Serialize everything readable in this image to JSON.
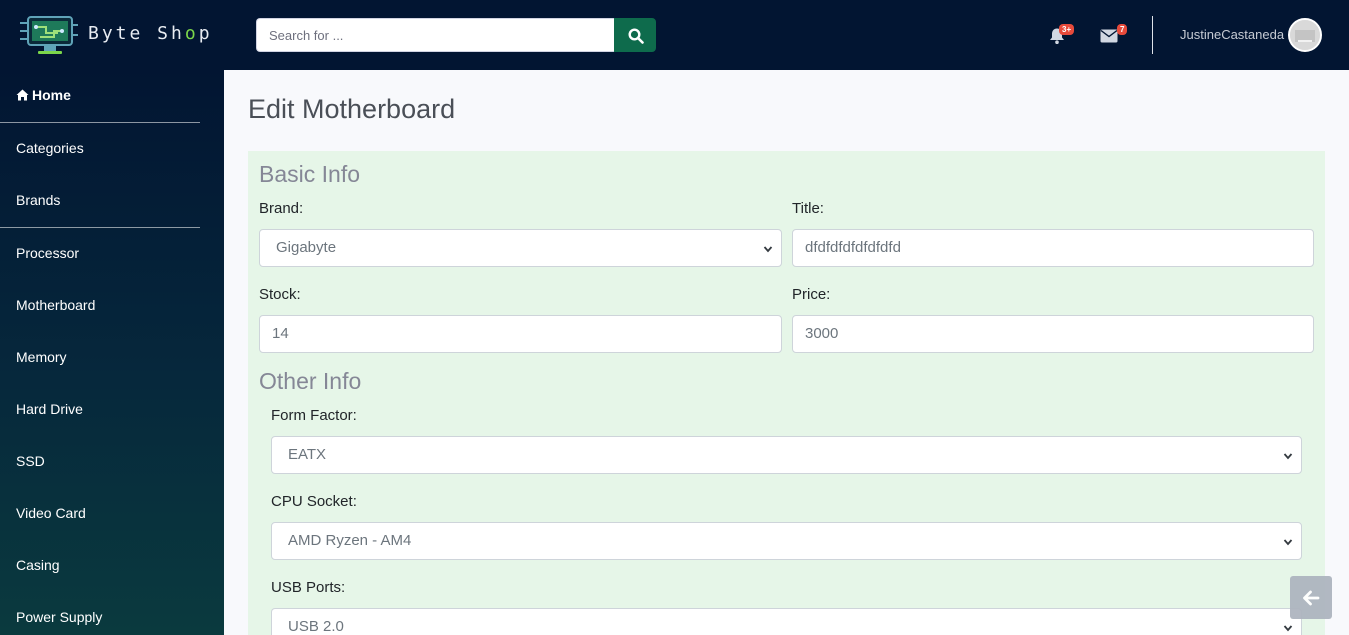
{
  "brand": {
    "name_part1": "Byte Sh",
    "name_o": "o",
    "name_part2": "p"
  },
  "search": {
    "placeholder": "Search for ..."
  },
  "notifications": {
    "alerts_count": "3+",
    "messages_count": "7"
  },
  "user": {
    "name": "JustineCastaneda"
  },
  "sidebar": {
    "items": [
      {
        "label": "Home"
      },
      {
        "label": "Categories"
      },
      {
        "label": "Brands"
      },
      {
        "label": "Processor"
      },
      {
        "label": "Motherboard"
      },
      {
        "label": "Memory"
      },
      {
        "label": "Hard Drive"
      },
      {
        "label": "SSD"
      },
      {
        "label": "Video Card"
      },
      {
        "label": "Casing"
      },
      {
        "label": "Power Supply"
      }
    ]
  },
  "page": {
    "title": "Edit Motherboard"
  },
  "form": {
    "basic_info_title": "Basic Info",
    "brand_label": "Brand:",
    "brand_value": "Gigabyte",
    "title_label": "Title:",
    "title_value": "dfdfdfdfdfdfdfd",
    "stock_label": "Stock:",
    "stock_value": "14",
    "price_label": "Price:",
    "price_value": "3000",
    "other_info_title": "Other Info",
    "form_factor_label": "Form Factor:",
    "form_factor_value": "EATX",
    "cpu_socket_label": "CPU Socket:",
    "cpu_socket_value": "AMD Ryzen - AM4",
    "usb_ports_label": "USB Ports:",
    "usb_ports_value": "USB 2.0"
  },
  "colors": {
    "topbar": "#021532",
    "search_button": "#0e6b4c",
    "card_bg": "#e6f6e8",
    "badge": "#e74a3b"
  }
}
